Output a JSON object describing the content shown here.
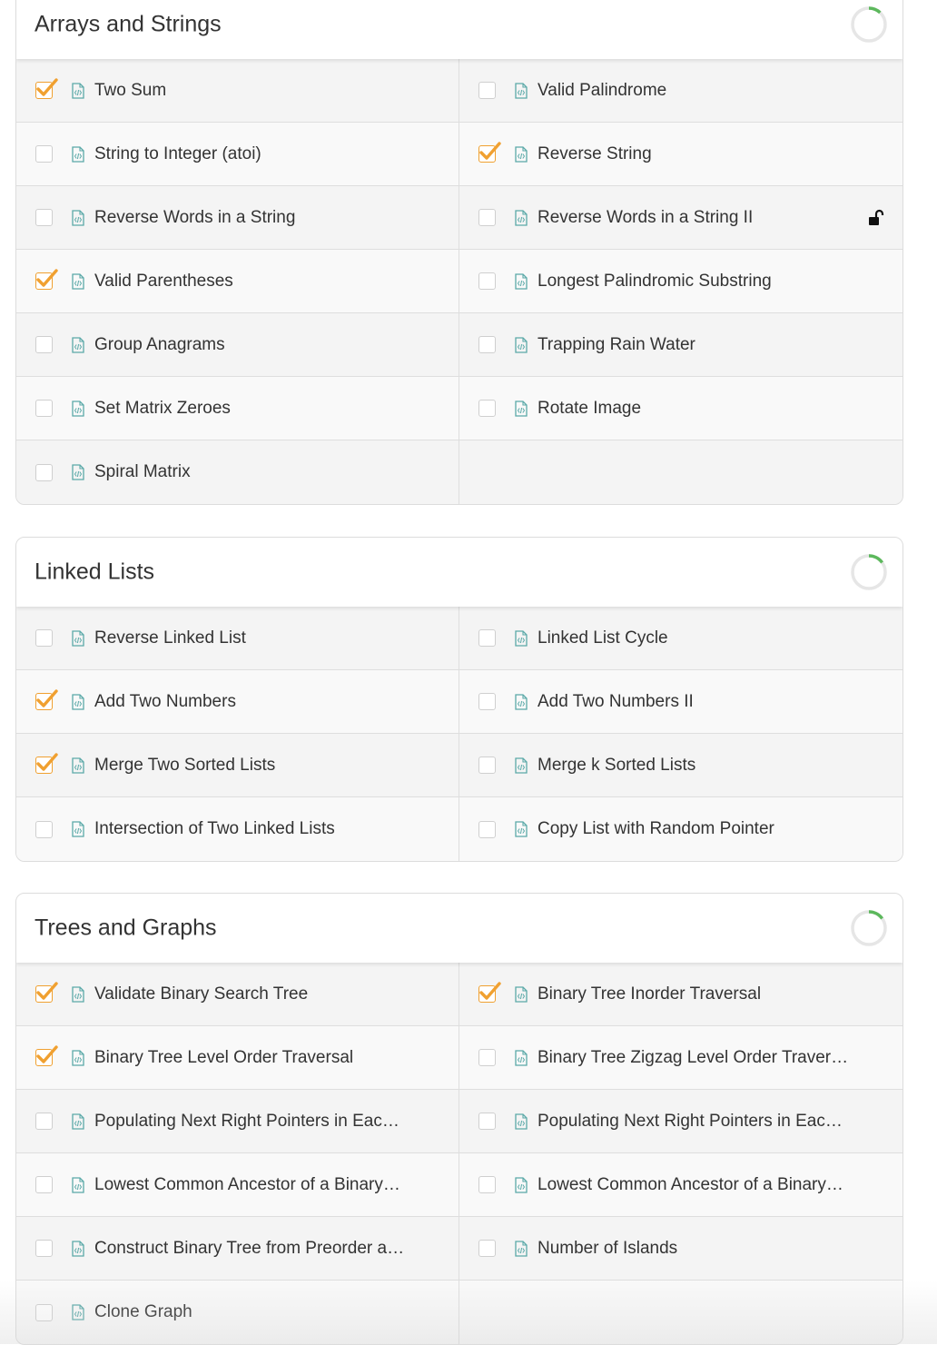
{
  "colors": {
    "accent_check": "#f0a030",
    "file_icon": "#5aa9a8",
    "progress": "#5cb85c"
  },
  "sections": [
    {
      "title": "Arrays and Strings",
      "progress": 0.12,
      "rows": [
        [
          {
            "title": "Two Sum",
            "checked": true
          },
          {
            "title": "Valid Palindrome",
            "checked": false
          }
        ],
        [
          {
            "title": "String to Integer (atoi)",
            "checked": false
          },
          {
            "title": "Reverse String",
            "checked": true
          }
        ],
        [
          {
            "title": "Reverse Words in a String",
            "checked": false
          },
          {
            "title": "Reverse Words in a String II",
            "checked": false,
            "locked": true
          }
        ],
        [
          {
            "title": "Valid Parentheses",
            "checked": true
          },
          {
            "title": "Longest Palindromic Substring",
            "checked": false
          }
        ],
        [
          {
            "title": "Group Anagrams",
            "checked": false
          },
          {
            "title": "Trapping Rain Water",
            "checked": false
          }
        ],
        [
          {
            "title": "Set Matrix Zeroes",
            "checked": false
          },
          {
            "title": "Rotate Image",
            "checked": false
          }
        ],
        [
          {
            "title": "Spiral Matrix",
            "checked": false
          },
          null
        ]
      ]
    },
    {
      "title": "Linked Lists",
      "progress": 0.15,
      "rows": [
        [
          {
            "title": "Reverse Linked List",
            "checked": false
          },
          {
            "title": "Linked List Cycle",
            "checked": false
          }
        ],
        [
          {
            "title": "Add Two Numbers",
            "checked": true
          },
          {
            "title": "Add Two Numbers II",
            "checked": false
          }
        ],
        [
          {
            "title": "Merge Two Sorted Lists",
            "checked": true
          },
          {
            "title": "Merge k Sorted Lists",
            "checked": false
          }
        ],
        [
          {
            "title": "Intersection of Two Linked Lists",
            "checked": false
          },
          {
            "title": "Copy List with Random Pointer",
            "checked": false
          }
        ]
      ]
    },
    {
      "title": "Trees and Graphs",
      "progress": 0.15,
      "rows": [
        [
          {
            "title": "Validate Binary Search Tree",
            "checked": true
          },
          {
            "title": "Binary Tree Inorder Traversal",
            "checked": true
          }
        ],
        [
          {
            "title": "Binary Tree Level Order Traversal",
            "checked": true
          },
          {
            "title": "Binary Tree Zigzag Level Order Traver…",
            "checked": false
          }
        ],
        [
          {
            "title": "Populating Next Right Pointers in Eac…",
            "checked": false
          },
          {
            "title": "Populating Next Right Pointers in Eac…",
            "checked": false
          }
        ],
        [
          {
            "title": "Lowest Common Ancestor of a Binary…",
            "checked": false
          },
          {
            "title": "Lowest Common Ancestor of a Binary…",
            "checked": false
          }
        ],
        [
          {
            "title": "Construct Binary Tree from Preorder a…",
            "checked": false
          },
          {
            "title": "Number of Islands",
            "checked": false
          }
        ],
        [
          {
            "title": "Clone Graph",
            "checked": false
          },
          null
        ]
      ]
    }
  ]
}
